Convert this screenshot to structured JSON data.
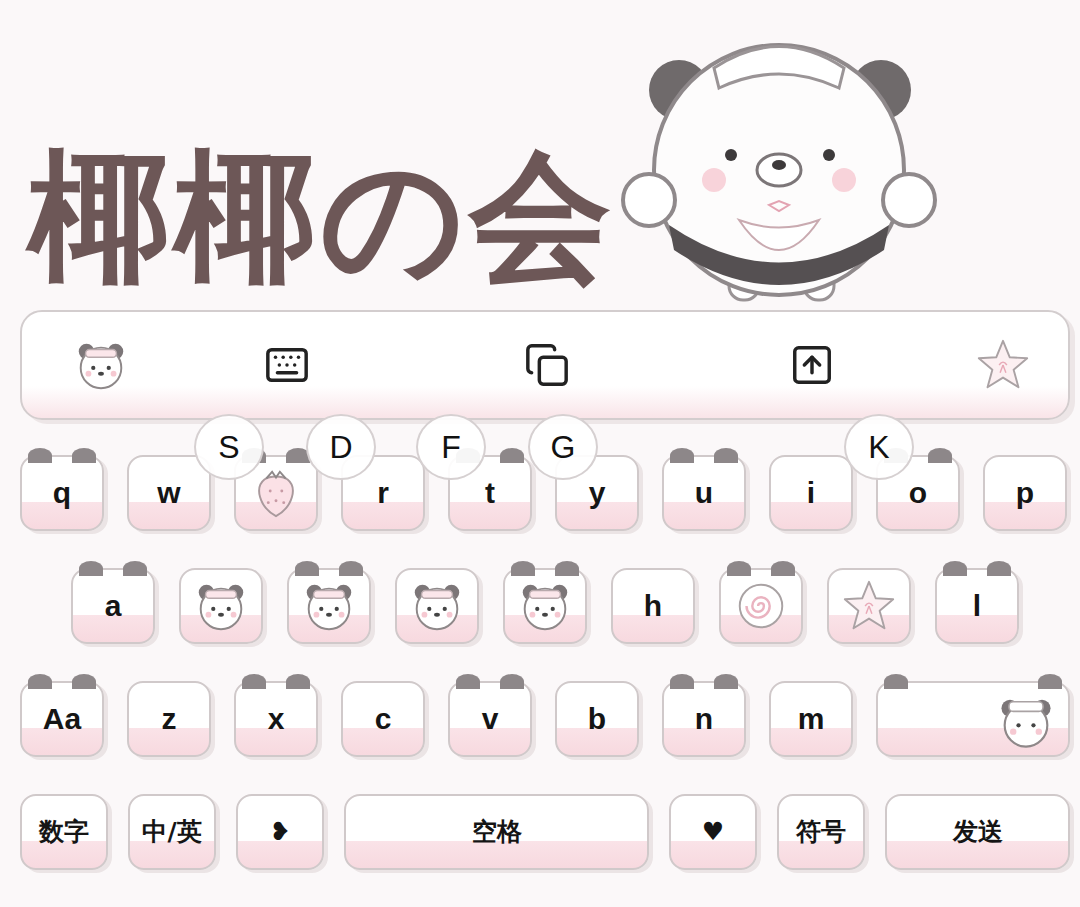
{
  "title": "椰椰の会",
  "popups": [
    "S",
    "D",
    "F",
    "G",
    "K"
  ],
  "rows": [
    [
      {
        "kind": "letter",
        "label": "q"
      },
      {
        "kind": "letter",
        "label": "w"
      },
      {
        "kind": "strawberry"
      },
      {
        "kind": "letter",
        "label": "r"
      },
      {
        "kind": "letter",
        "label": "t"
      },
      {
        "kind": "letter",
        "label": "y"
      },
      {
        "kind": "letter",
        "label": "u"
      },
      {
        "kind": "letter",
        "label": "i"
      },
      {
        "kind": "letter",
        "label": "o"
      },
      {
        "kind": "letter",
        "label": "p"
      }
    ],
    [
      {
        "kind": "letter",
        "label": "a"
      },
      {
        "kind": "panda"
      },
      {
        "kind": "panda"
      },
      {
        "kind": "panda"
      },
      {
        "kind": "panda"
      },
      {
        "kind": "letter",
        "label": "h"
      },
      {
        "kind": "roll"
      },
      {
        "kind": "star"
      },
      {
        "kind": "letter",
        "label": "l"
      }
    ],
    [
      {
        "kind": "letter",
        "label": "Aa"
      },
      {
        "kind": "letter",
        "label": "z"
      },
      {
        "kind": "letter",
        "label": "x"
      },
      {
        "kind": "letter",
        "label": "c"
      },
      {
        "kind": "letter",
        "label": "v"
      },
      {
        "kind": "letter",
        "label": "b"
      },
      {
        "kind": "letter",
        "label": "n"
      },
      {
        "kind": "letter",
        "label": "m"
      },
      {
        "kind": "enter"
      }
    ],
    [
      {
        "kind": "function",
        "label": "数字"
      },
      {
        "kind": "function",
        "label": "中/英"
      },
      {
        "kind": "function",
        "label": "❥"
      },
      {
        "kind": "space",
        "label": "空格"
      },
      {
        "kind": "function",
        "label": "♥"
      },
      {
        "kind": "function",
        "label": "符号"
      },
      {
        "kind": "send",
        "label": "发送"
      }
    ]
  ]
}
